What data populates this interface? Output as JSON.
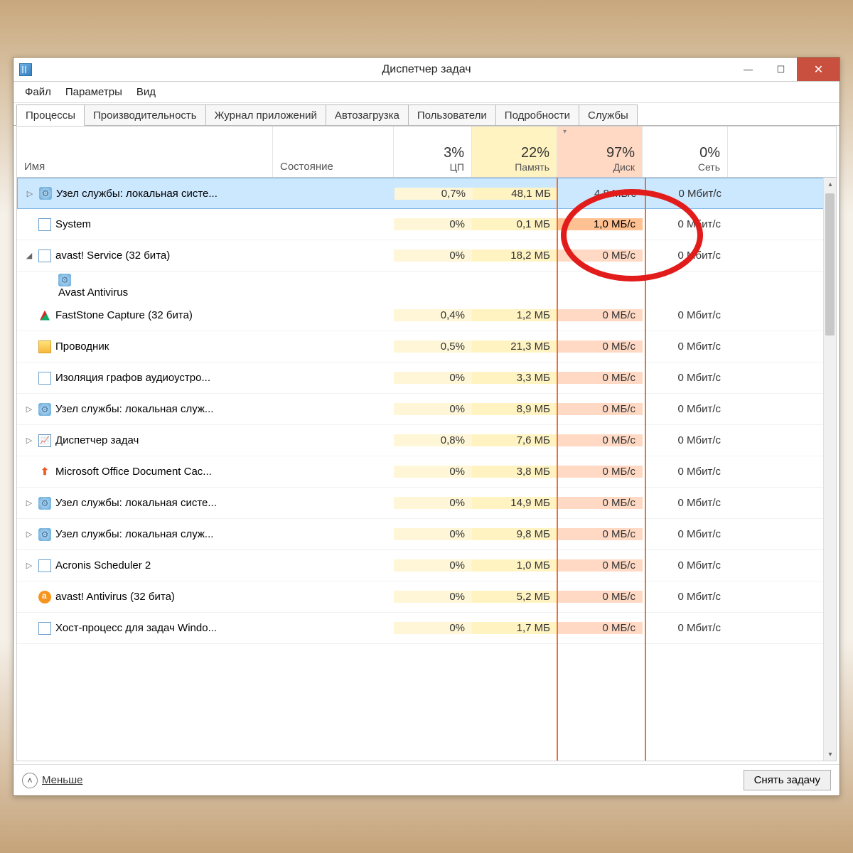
{
  "window": {
    "title": "Диспетчер задач",
    "menu": [
      "Файл",
      "Параметры",
      "Вид"
    ],
    "tabs": [
      "Процессы",
      "Производительность",
      "Журнал приложений",
      "Автозагрузка",
      "Пользователи",
      "Подробности",
      "Службы"
    ],
    "active_tab": 0
  },
  "columns": {
    "name": "Имя",
    "state": "Состояние",
    "cpu": {
      "pct": "3%",
      "label": "ЦП"
    },
    "memory": {
      "pct": "22%",
      "label": "Память"
    },
    "disk": {
      "pct": "97%",
      "label": "Диск"
    },
    "network": {
      "pct": "0%",
      "label": "Сеть"
    }
  },
  "processes": [
    {
      "exp": "▷",
      "icon": "gear",
      "name": "Узел службы: локальная систе...",
      "state": "",
      "cpu": "0,7%",
      "mem": "48,1 МБ",
      "disk": "4,8 МБ/с",
      "net": "0 Мбит/с",
      "selected": true
    },
    {
      "exp": "",
      "icon": "app",
      "name": "System",
      "state": "",
      "cpu": "0%",
      "mem": "0,1 МБ",
      "disk": "1,0 МБ/с",
      "net": "0 Мбит/с",
      "highdisk": true
    },
    {
      "exp": "◢",
      "icon": "app",
      "name": "avast! Service (32 бита)",
      "state": "",
      "cpu": "0%",
      "mem": "18,2 МБ",
      "disk": "0 МБ/с",
      "net": "0 Мбит/с",
      "expanded": true
    },
    {
      "child": true,
      "icon": "gear",
      "name": "Avast Antivirus",
      "cpu": "",
      "mem": "",
      "disk": "",
      "net": ""
    },
    {
      "exp": "",
      "icon": "faststone",
      "name": "FastStone Capture (32 бита)",
      "state": "",
      "cpu": "0,4%",
      "mem": "1,2 МБ",
      "disk": "0 МБ/с",
      "net": "0 Мбит/с"
    },
    {
      "exp": "",
      "icon": "explorer",
      "name": "Проводник",
      "state": "",
      "cpu": "0,5%",
      "mem": "21,3 МБ",
      "disk": "0 МБ/с",
      "net": "0 Мбит/с"
    },
    {
      "exp": "",
      "icon": "app",
      "name": "Изоляция графов аудиоустро...",
      "state": "",
      "cpu": "0%",
      "mem": "3,3 МБ",
      "disk": "0 МБ/с",
      "net": "0 Мбит/с"
    },
    {
      "exp": "▷",
      "icon": "gear",
      "name": "Узел службы: локальная служ...",
      "state": "",
      "cpu": "0%",
      "mem": "8,9 МБ",
      "disk": "0 МБ/с",
      "net": "0 Мбит/с"
    },
    {
      "exp": "▷",
      "icon": "taskmgr",
      "name": "Диспетчер задач",
      "state": "",
      "cpu": "0,8%",
      "mem": "7,6 МБ",
      "disk": "0 МБ/с",
      "net": "0 Мбит/с"
    },
    {
      "exp": "",
      "icon": "office",
      "name": "Microsoft Office Document Cac...",
      "state": "",
      "cpu": "0%",
      "mem": "3,8 МБ",
      "disk": "0 МБ/с",
      "net": "0 Мбит/с"
    },
    {
      "exp": "▷",
      "icon": "gear",
      "name": "Узел службы: локальная систе...",
      "state": "",
      "cpu": "0%",
      "mem": "14,9 МБ",
      "disk": "0 МБ/с",
      "net": "0 Мбит/с"
    },
    {
      "exp": "▷",
      "icon": "gear",
      "name": "Узел службы: локальная служ...",
      "state": "",
      "cpu": "0%",
      "mem": "9,8 МБ",
      "disk": "0 МБ/с",
      "net": "0 Мбит/с"
    },
    {
      "exp": "▷",
      "icon": "app",
      "name": "Acronis Scheduler 2",
      "state": "",
      "cpu": "0%",
      "mem": "1,0 МБ",
      "disk": "0 МБ/с",
      "net": "0 Мбит/с"
    },
    {
      "exp": "",
      "icon": "avast-o",
      "name": "avast! Antivirus (32 бита)",
      "state": "",
      "cpu": "0%",
      "mem": "5,2 МБ",
      "disk": "0 МБ/с",
      "net": "0 Мбит/с"
    },
    {
      "exp": "",
      "icon": "app",
      "name": "Хост-процесс для задач Windo...",
      "state": "",
      "cpu": "0%",
      "mem": "1,7 МБ",
      "disk": "0 МБ/с",
      "net": "0 Мбит/с"
    }
  ],
  "footer": {
    "less": "Меньше",
    "end_task": "Снять задачу"
  }
}
